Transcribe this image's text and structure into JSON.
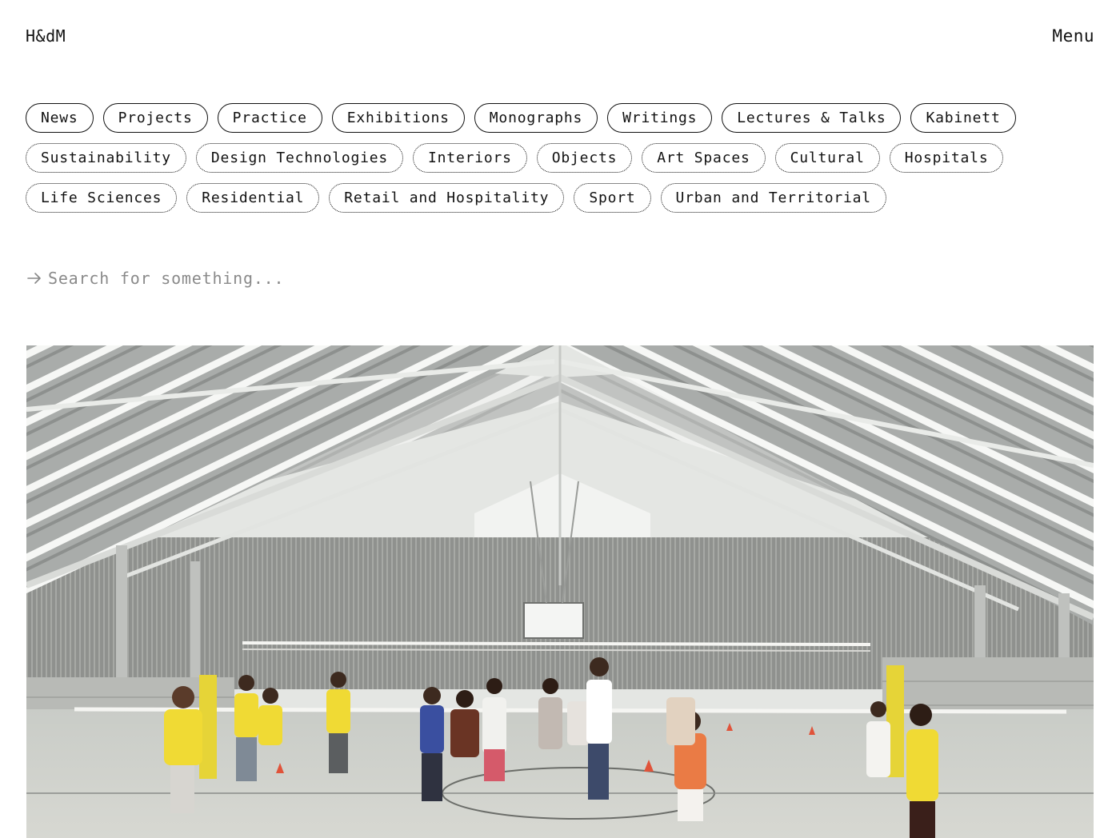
{
  "header": {
    "logo": "H&dM",
    "menu_label": "Menu"
  },
  "categories": {
    "primary": [
      "News",
      "Projects",
      "Practice",
      "Exhibitions",
      "Monographs",
      "Writings",
      "Lectures & Talks",
      "Kabinett"
    ],
    "secondary_row1": [
      "Sustainability",
      "Design Technologies",
      "Interiors",
      "Objects",
      "Art Spaces",
      "Cultural",
      "Hospitals"
    ],
    "secondary_row2": [
      "Life Sciences",
      "Residential",
      "Retail and Hospitality",
      "Sport",
      "Urban and Territorial"
    ]
  },
  "search": {
    "placeholder": "Search for something...",
    "value": ""
  },
  "hero": {
    "icon": "arrow-right-icon"
  }
}
